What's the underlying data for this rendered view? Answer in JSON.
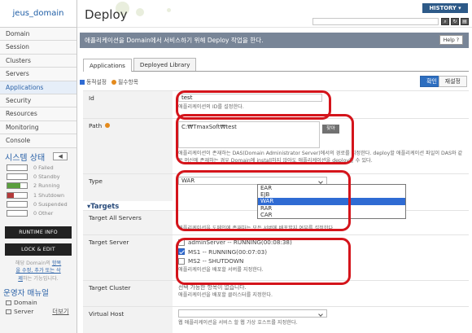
{
  "sidebar": {
    "domain_name": "jeus_domain",
    "menu": [
      "Domain",
      "Session",
      "Clusters",
      "Servers",
      "Applications",
      "Security",
      "Resources",
      "Monitoring",
      "Console"
    ],
    "active_index": 4,
    "status_title": "시스템 상태",
    "status_toggle": "◀",
    "status": [
      {
        "count": "0",
        "label": "Failed",
        "value": 0,
        "color": "#c0392b"
      },
      {
        "count": "0",
        "label": "Standby",
        "value": 0,
        "color": "#999999"
      },
      {
        "count": "2",
        "label": "Running",
        "value": 0.667,
        "color": "#5a9e3d"
      },
      {
        "count": "1",
        "label": "Shutdown",
        "value": 0.333,
        "color": "#b43a3a"
      },
      {
        "count": "0",
        "label": "Suspended",
        "value": 0,
        "color": "#999999"
      },
      {
        "count": "0",
        "label": "Other",
        "value": 0,
        "color": "#999999"
      }
    ],
    "runtime_info": "RUNTIME INFO",
    "lock_edit": "LOCK & EDIT",
    "note_line1": "해당 Domain의 ",
    "note_link1": "항목",
    "note_link2": "을 수정, 추가 또는 삭",
    "note_link3": "제",
    "note_line2": "하는 기능입니다.",
    "ops_title": "운영자 매뉴얼",
    "links": [
      "Domain",
      "Server"
    ],
    "more": "더보기"
  },
  "header": {
    "title": "Deploy",
    "history": "HISTORY ▾",
    "banner": "애플리케이션을 Domain에서 서비스하기 위해 Deploy 작업을 한다.",
    "help": "Help ?"
  },
  "tabs": [
    "Applications",
    "Deployed Library"
  ],
  "legend": {
    "dynamic": "동적설정",
    "required": "필수항목",
    "dynamic_color": "#2f6bd3",
    "required_color": "#e48a1c"
  },
  "buttons": {
    "ok": "확인",
    "reset": "재설정",
    "browse": "찾아"
  },
  "form": {
    "id_label": "Id",
    "id_value": "test",
    "id_hint": "애플리케이션의 ID를 설정한다.",
    "path_label": "Path",
    "path_value": "C:₩TmaxSoft₩test",
    "path_hint1": "애플리케이션이 존재하는 DAS(Domain Administrator Server)에서의 경로를 지정한다. deploy할 애플리케이션 파일이 DAS와 같",
    "path_hint2": "은 머신에 존재하는 경우 Domain에 install하지 않아도 애플리케이션을 deploy할 수 있다.",
    "type_label": "Type",
    "type_value": "WAR",
    "type_hint": "니라 값을설정할 수 있다.",
    "type_options": [
      "EAR",
      "EJB",
      "WAR",
      "RAR",
      "CAR"
    ],
    "type_selected": 2,
    "targets_heading": "Targets",
    "all_label": "Target All Servers",
    "all_hint": "애플리케이션을 도메인에 존재하는 모든 서버에 배포할지 여부를 설정한다.",
    "server_label": "Target Server",
    "servers": [
      {
        "name": "adminServer -- RUNNING(00:08:38)",
        "checked": false
      },
      {
        "name": "MS1 -- RUNNING(00:07:03)",
        "checked": true
      },
      {
        "name": "MS2 -- SHUTDOWN",
        "checked": false
      }
    ],
    "server_hint": "애플리케이션을 배포할 서버를 지정한다.",
    "cluster_label": "Target Cluster",
    "cluster_text1": "선택 가능한 항목이 없습니다.",
    "cluster_text2": "애플리케이션을 배포할 클러스터를 지정한다.",
    "vhost_label": "Virtual Host",
    "vhost_value": "",
    "vhost_hint": "웹 애플리케이션을 서비스 할 웹 가상 호스트를 지정한다."
  },
  "highlight_color": "#d4141b"
}
